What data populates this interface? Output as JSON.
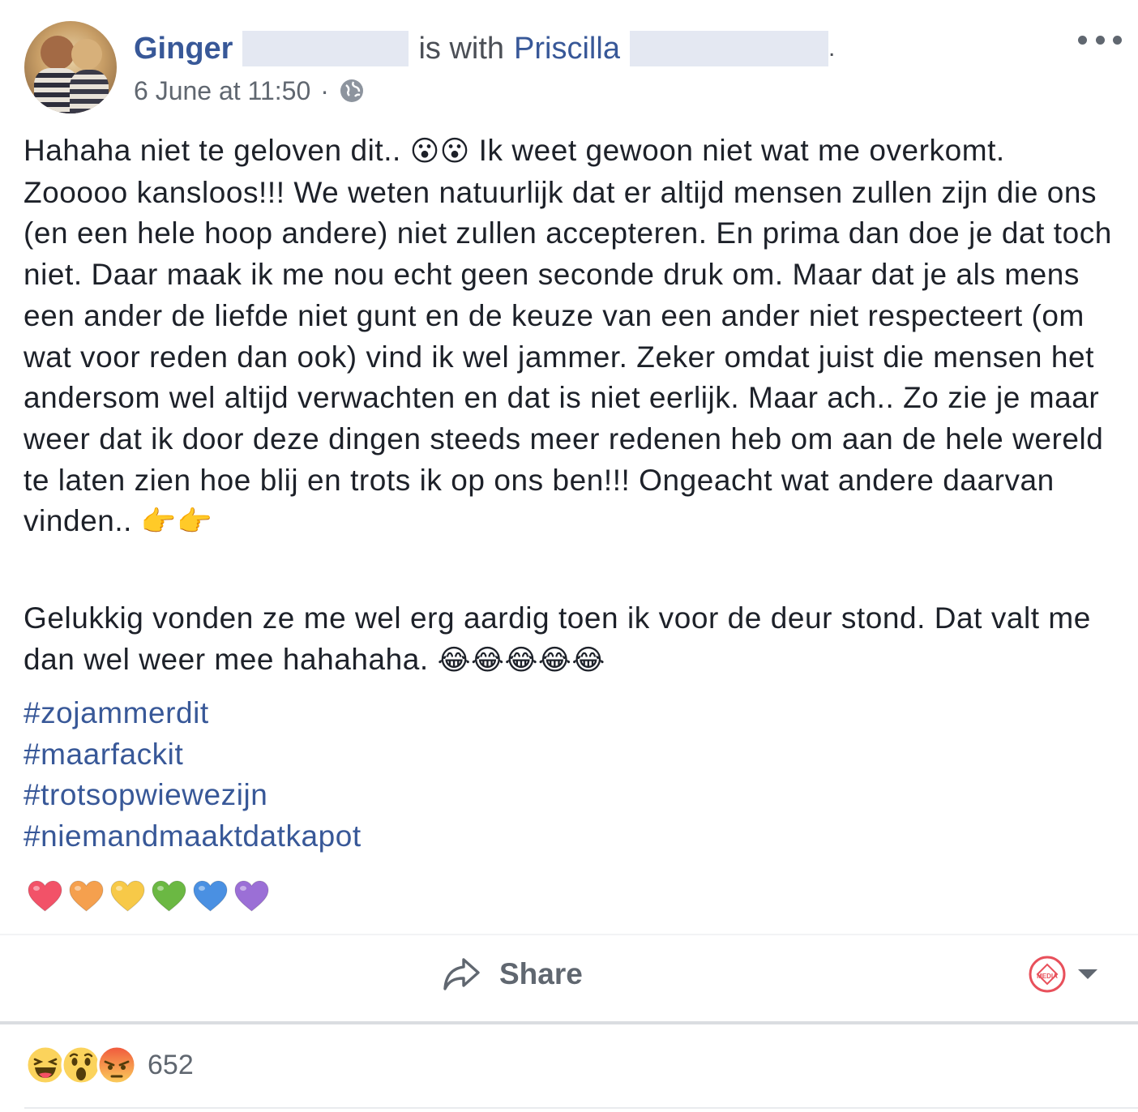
{
  "header": {
    "author_name": "Ginger",
    "with_text": "is with",
    "tagged_name": "Priscilla",
    "period": ".",
    "timestamp": "6 June at 11:50",
    "separator": "·",
    "privacy_icon": "globe-icon",
    "more_icon": "more-options-icon"
  },
  "post": {
    "seg1": "Hahaha niet te geloven dit..",
    "emoji_surprise": "😮😮",
    "seg2": "Ik weet gewoon niet wat me overkomt. Zooooo kansloos!!! We weten natuurlijk dat er altijd mensen zullen zijn die ons (en een hele hoop andere) niet zullen accepteren. En prima dan doe je dat toch niet. Daar maak ik me nou echt geen seconde druk om. Maar dat je als mens een ander de liefde niet gunt en de keuze van een ander niet respecteert (om wat voor reden dan ook) vind ik wel jammer. Zeker omdat juist die mensen het andersom wel altijd verwachten en dat is niet eerlijk. Maar ach.. Zo zie je maar weer dat ik door deze dingen steeds meer redenen heb om aan de hele wereld te laten zien hoe blij en trots ik op ons ben!!! Ongeacht wat andere daarvan vinden..",
    "emoji_thumbs": "👉👉",
    "para2": "Gelukkig vonden ze me wel erg aardig toen ik voor de deur stond. Dat valt me dan wel weer mee hahahaha.",
    "emoji_laugh": "😂😂😂😂😂",
    "hashtags": [
      "#zojammerdit",
      "#maarfackit",
      "#trotsopwiewezijn",
      "#niemandmaaktdatkapot"
    ],
    "hearts": [
      "#f25268",
      "#f5a04e",
      "#f7c948",
      "#6bb843",
      "#4a90e2",
      "#9b6fd6"
    ]
  },
  "actions": {
    "share_label": "Share",
    "share_icon": "share-arrow-icon",
    "page_logo_text": "MEDIA",
    "dropdown_icon": "caret-down-icon"
  },
  "reactions": {
    "icons": [
      "haha-icon",
      "wow-icon",
      "angry-icon"
    ],
    "count": "652"
  }
}
